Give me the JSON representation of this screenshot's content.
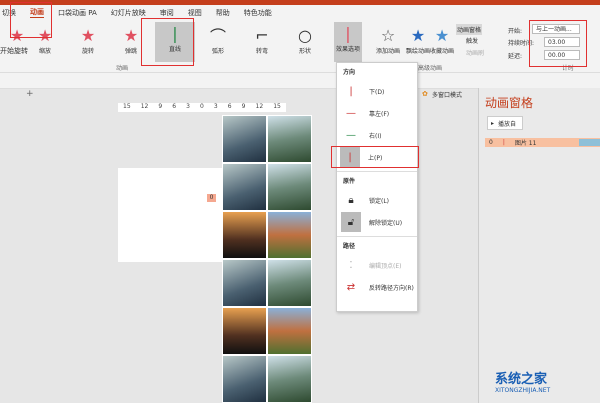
{
  "tabs": [
    "切换",
    "动画",
    "口袋动画 PA",
    "幻灯片放映",
    "审阅",
    "视图",
    "帮助",
    "特色功能"
  ],
  "active_tab": "动画",
  "effects": [
    {
      "label": "开始旋转"
    },
    {
      "label": "缩放"
    },
    {
      "label": "旋转"
    },
    {
      "label": "弹跳"
    },
    {
      "label": "直线",
      "selected": true
    },
    {
      "label": "弧形"
    },
    {
      "label": "转弯"
    },
    {
      "label": "形状"
    }
  ],
  "group_animation": "动画",
  "effect_options": "效果选项",
  "advanced": {
    "add": "添加动画",
    "painter": "飘绘动画",
    "collect": "收藏动画",
    "pane": "动画窗格",
    "trigger": "触发",
    "animation_painter": "动画刷",
    "group": "高级动画"
  },
  "timing": {
    "start_label": "开始:",
    "start_value": "与上一动画...",
    "duration_label": "持续时间:",
    "duration": "03.00",
    "delay_label": "延迟:",
    "delay": "00.00",
    "group": "计时"
  },
  "multi_window": "多窗口模式",
  "ruler": [
    "15",
    "12",
    "9",
    "6",
    "3",
    "0",
    "3",
    "6",
    "9",
    "12",
    "15"
  ],
  "slide_tag": "0",
  "menu": {
    "direction_header": "方向",
    "direction": [
      "下(D)",
      "靠左(F)",
      "右(I)",
      "上(P)"
    ],
    "selected_direction": "上(P)",
    "sequence_header": "原件",
    "lock": [
      "锁定(L)",
      "解除锁定(U)"
    ],
    "path_header": "路径",
    "path": [
      "编辑顶点(E)",
      "反转路径方向(R)"
    ]
  },
  "pane": {
    "title": "动画窗格",
    "play": "播放自",
    "item_index": "0",
    "item_name": "图片 11"
  },
  "watermark": {
    "name": "系统之家",
    "url": "XITONGZHIJIA.NET"
  },
  "colors": {
    "accent": "#c43e1c",
    "highlight": "#e03030",
    "selected_row": "#f8c0a0"
  }
}
